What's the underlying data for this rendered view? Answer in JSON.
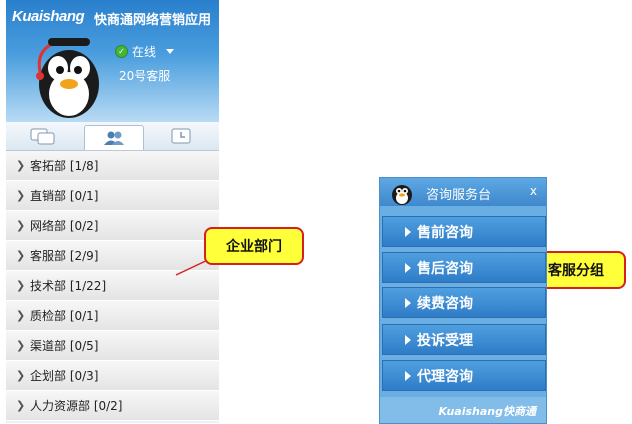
{
  "header": {
    "brand_latin": "Kuaishang",
    "brand_cn": "快商通网络营销应用",
    "status": "在线",
    "username": "20号客服"
  },
  "tabs": [
    {
      "icon": "chat-bubble-icon"
    },
    {
      "icon": "contacts-icon"
    },
    {
      "icon": "history-icon"
    }
  ],
  "departments": [
    {
      "label": "客拓部 [1/8]"
    },
    {
      "label": "直销部 [0/1]"
    },
    {
      "label": "网络部 [0/2]"
    },
    {
      "label": "客服部 [2/9]"
    },
    {
      "label": "技术部 [1/22]"
    },
    {
      "label": "质检部 [0/1]"
    },
    {
      "label": "渠道部 [0/5]"
    },
    {
      "label": "企划部 [0/3]"
    },
    {
      "label": "人力资源部 [0/2]"
    }
  ],
  "callouts": {
    "departments": "企业部门",
    "service_groups": "客服分组"
  },
  "widget": {
    "title": "咨询服务台",
    "close": "x",
    "buttons": [
      {
        "label": "售前咨询"
      },
      {
        "label": "售后咨询"
      },
      {
        "label": "续费咨询"
      },
      {
        "label": "投诉受理"
      },
      {
        "label": "代理咨询"
      }
    ],
    "footer_brand_latin": "Kuaishang",
    "footer_brand_cn": "快商通"
  },
  "colors": {
    "header_blue": "#2a7fcd",
    "widget_blue": "#3e88cc",
    "callout_fill": "#ffff3a",
    "callout_border": "#d62020",
    "online_green": "#45b53a"
  }
}
